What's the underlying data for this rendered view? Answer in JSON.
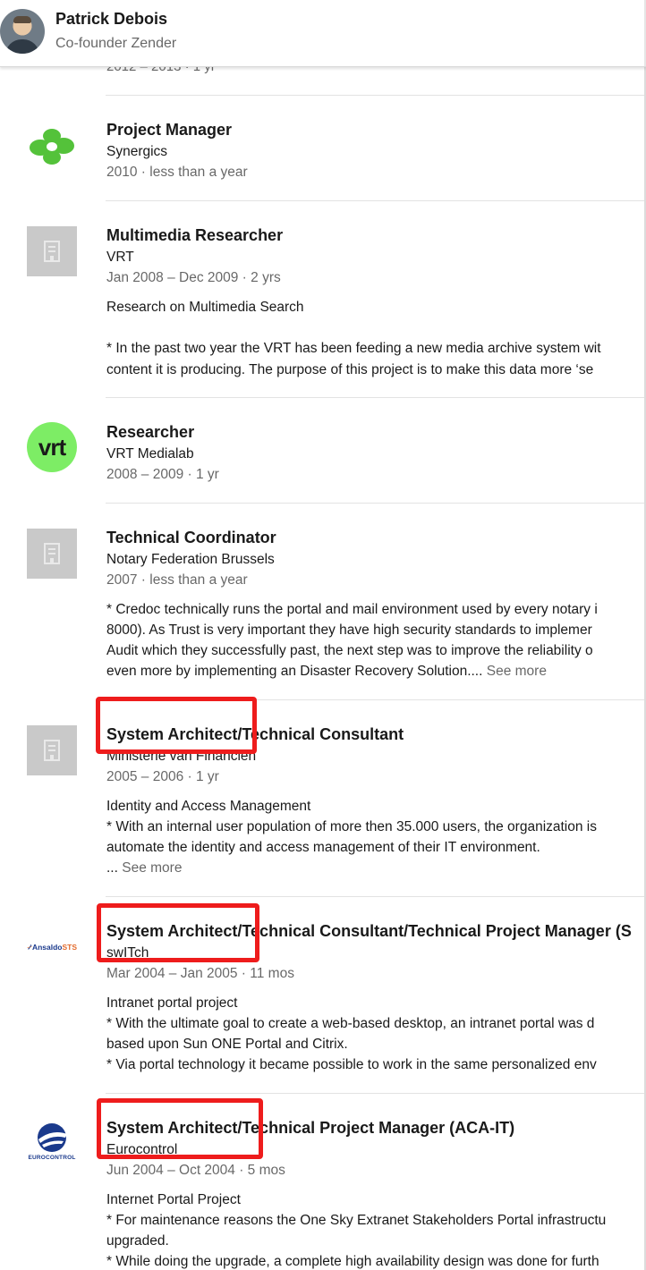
{
  "header": {
    "name": "Patrick Debois",
    "subtitle": "Co-founder Zender"
  },
  "cutoff_previous": "2012 – 2013 · 1 yr",
  "experiences": [
    {
      "title": "Project Manager",
      "company": "Synergics",
      "dates": "2010 · less than a year",
      "logo": "synergics-logo",
      "description": []
    },
    {
      "title": "Multimedia Researcher",
      "company": "VRT",
      "dates": "Jan 2008 – Dec 2009 · 2 yrs",
      "logo": "company-placeholder-icon",
      "description": [
        "Research on Multimedia Search",
        "",
        "* In the past two year the VRT has been feeding a new media archive system wit",
        "content it is producing. The purpose of this project is to make this data more ‘se"
      ]
    },
    {
      "title": "Researcher",
      "company": "VRT Medialab",
      "dates": "2008 – 2009 · 1 yr",
      "logo": "vrt-logo",
      "logo_text": "vrt",
      "description": []
    },
    {
      "title": "Technical Coordinator",
      "company": "Notary Federation Brussels",
      "dates": "2007 · less than a year",
      "logo": "company-placeholder-icon",
      "description": [
        "* Credoc technically runs the portal and mail environment used by every notary i",
        "8000). As Trust is very important they have high security standards to implemer",
        "Audit which they successfully past, the next step was to improve the reliability o",
        "even more by implementing an Disaster Recovery Solution...."
      ],
      "see_more": "See more"
    },
    {
      "title": "System Architect/Technical Consultant",
      "company": "Ministerie van Financiën",
      "dates": "2005 – 2006 · 1 yr",
      "logo": "company-placeholder-icon",
      "description": [
        "Identity and Access Management",
        "* With an internal user population of more then 35.000 users, the organization is",
        "automate the identity and access management of their IT environment.",
        "..."
      ],
      "see_more": "See more"
    },
    {
      "title": "System Architect/Technical Consultant/Technical Project Manager (S",
      "company": "swITch",
      "dates": "Mar 2004 – Jan 2005 · 11 mos",
      "logo": "ansaldo-sts-logo",
      "logo_text": "Ansaldo",
      "logo_text_accent": "STS",
      "description": [
        "Intranet portal project",
        "* With the ultimate goal to create a web-based desktop, an intranet portal was d",
        "based upon Sun ONE Portal and Citrix.",
        "* Via portal technology it became possible to work in the same personalized env"
      ]
    },
    {
      "title": "System Architect/Technical Project Manager (ACA-IT)",
      "company": "Eurocontrol",
      "dates": "Jun 2004 – Oct 2004 · 5 mos",
      "logo": "eurocontrol-logo",
      "logo_text": "EUROCONTROL",
      "description": [
        "Internet Portal Project",
        "* For maintenance reasons the One Sky Extranet Stakeholders Portal infrastructu",
        "upgraded.",
        "* While doing the upgrade, a complete high availability design was done for furth"
      ]
    }
  ],
  "colors": {
    "annotation_red": "#ee1c1c",
    "vrt_green": "#7ded65",
    "synergics_green": "#54c23a"
  }
}
